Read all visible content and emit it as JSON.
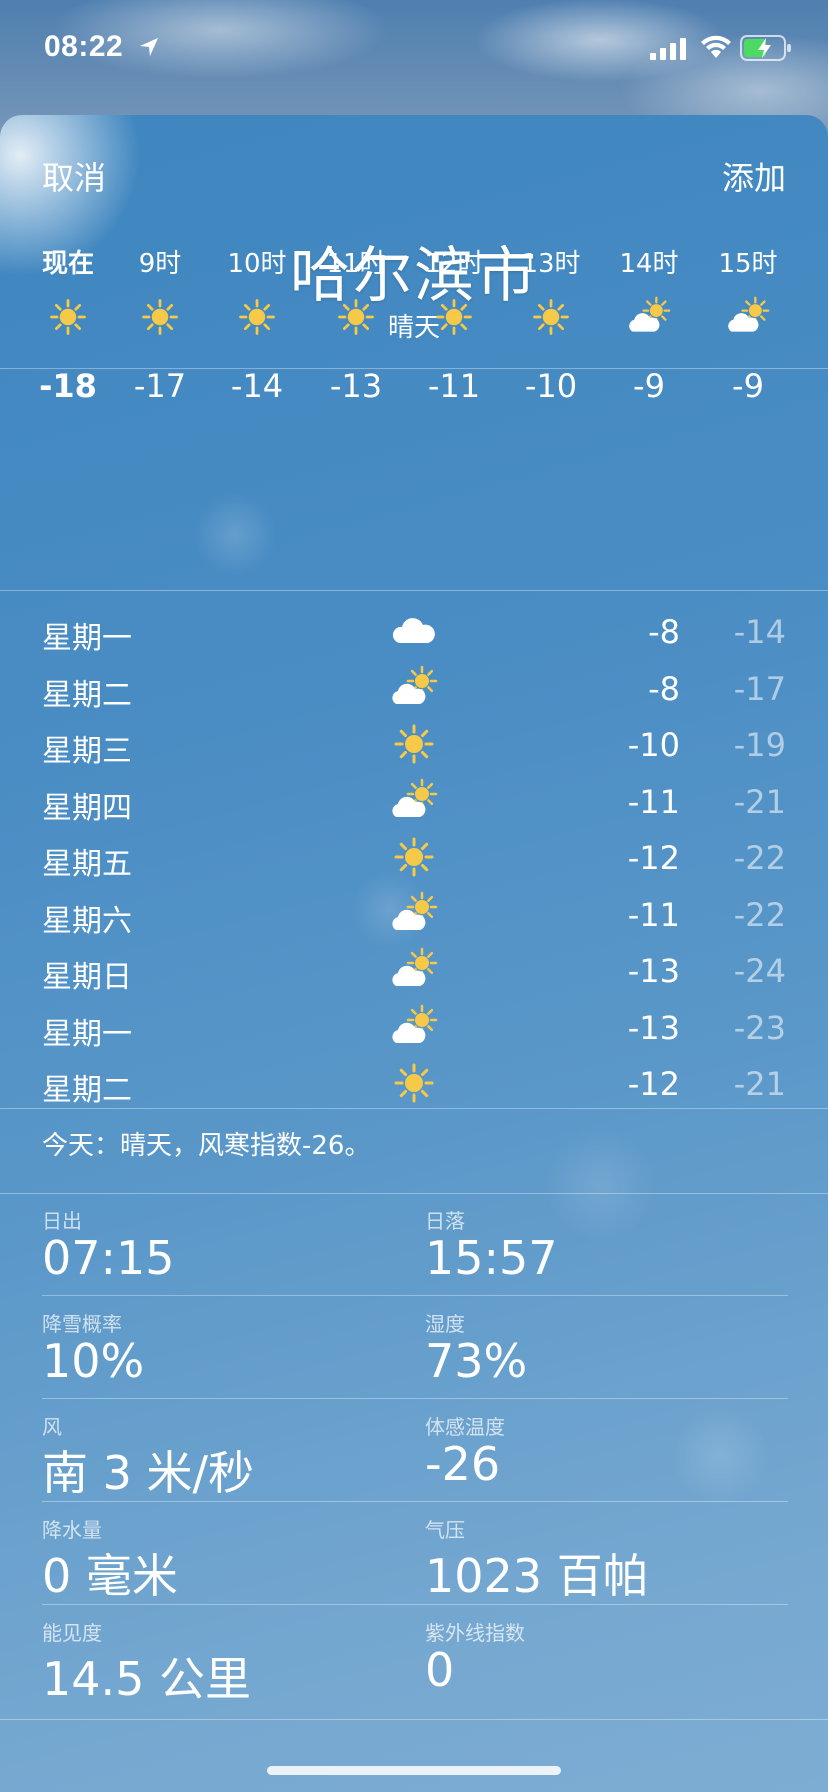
{
  "status_bar": {
    "time": "08:22",
    "icons": [
      "location-arrow-icon",
      "signal-icon",
      "wifi-icon",
      "battery-charging-icon"
    ]
  },
  "header": {
    "cancel_label": "取消",
    "add_label": "添加"
  },
  "location": {
    "city": "哈尔滨市",
    "condition": "晴天"
  },
  "hourly": [
    {
      "label": "现在",
      "icon": "sun-icon",
      "temp": "-18"
    },
    {
      "label": "9时",
      "icon": "sun-icon",
      "temp": "-17"
    },
    {
      "label": "10时",
      "icon": "sun-icon",
      "temp": "-14"
    },
    {
      "label": "11时",
      "icon": "sun-icon",
      "temp": "-13"
    },
    {
      "label": "12时",
      "icon": "sun-icon",
      "temp": "-11"
    },
    {
      "label": "13时",
      "icon": "sun-icon",
      "temp": "-10"
    },
    {
      "label": "14时",
      "icon": "partly-cloudy-icon",
      "temp": "-9"
    },
    {
      "label": "15时",
      "icon": "partly-cloudy-icon",
      "temp": "-9"
    }
  ],
  "daily": [
    {
      "day": "星期一",
      "icon": "cloud-icon",
      "high": "-8",
      "low": "-14"
    },
    {
      "day": "星期二",
      "icon": "partly-cloudy-icon",
      "high": "-8",
      "low": "-17"
    },
    {
      "day": "星期三",
      "icon": "sun-icon",
      "high": "-10",
      "low": "-19"
    },
    {
      "day": "星期四",
      "icon": "partly-cloudy-icon",
      "high": "-11",
      "low": "-21"
    },
    {
      "day": "星期五",
      "icon": "sun-icon",
      "high": "-12",
      "low": "-22"
    },
    {
      "day": "星期六",
      "icon": "partly-cloudy-icon",
      "high": "-11",
      "low": "-22"
    },
    {
      "day": "星期日",
      "icon": "partly-cloudy-icon",
      "high": "-13",
      "low": "-24"
    },
    {
      "day": "星期一",
      "icon": "partly-cloudy-icon",
      "high": "-13",
      "low": "-23"
    },
    {
      "day": "星期二",
      "icon": "sun-icon",
      "high": "-12",
      "low": "-21"
    }
  ],
  "summary": "今天：晴天，风寒指数-26。",
  "details": [
    {
      "label": "日出",
      "value": "07:15"
    },
    {
      "label": "日落",
      "value": "15:57"
    },
    {
      "label": "降雪概率",
      "value": "10%"
    },
    {
      "label": "湿度",
      "value": "73%"
    },
    {
      "label": "风",
      "value": "南 3 米/秒"
    },
    {
      "label": "体感温度",
      "value": "-26"
    },
    {
      "label": "降水量",
      "value": "0 毫米"
    },
    {
      "label": "气压",
      "value": "1023 百帕"
    },
    {
      "label": "能见度",
      "value": "14.5 公里"
    },
    {
      "label": "紫外线指数",
      "value": "0"
    }
  ],
  "colors": {
    "sun": "#f7c948",
    "cloud": "#ffffff",
    "text": "#ffffff"
  }
}
